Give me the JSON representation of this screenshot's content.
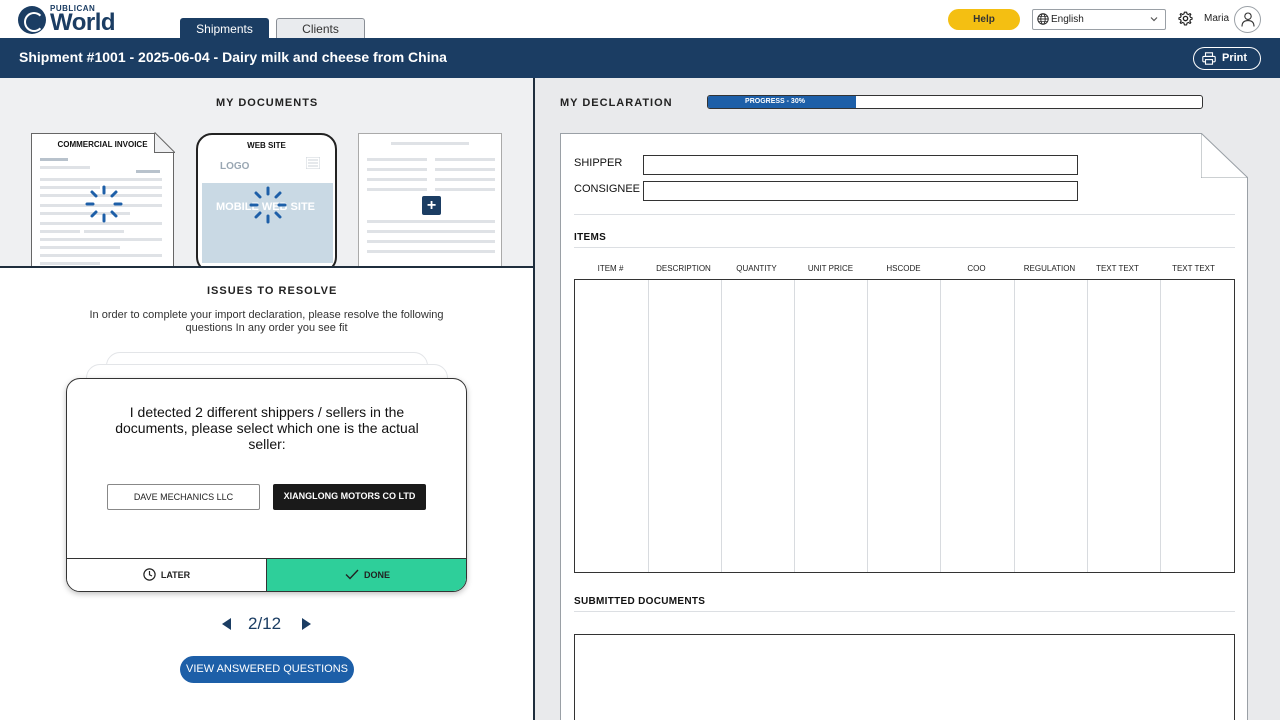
{
  "brand": {
    "logo_sub": "PUBLICAN",
    "logo_main": "World"
  },
  "nav": {
    "tabs": [
      {
        "label": "Shipments",
        "active": true
      },
      {
        "label": "Clients",
        "active": false
      }
    ]
  },
  "header": {
    "help_label": "Help",
    "language": "English",
    "user_name": "Maria"
  },
  "shipment": {
    "title": "Shipment #1001 - 2025-06-04 - Dairy milk and cheese from China",
    "print_label": "Print"
  },
  "documents": {
    "heading": "MY DOCUMENTS",
    "cards": [
      {
        "label": "COMMERCIAL INVOICE",
        "loading": true
      },
      {
        "label": "WEB SITE",
        "loading": true,
        "logo_text": "LOGO",
        "hero_text": "MOBILE WEB SITE"
      },
      {
        "label": "",
        "action": "add"
      }
    ]
  },
  "issues": {
    "heading": "ISSUES TO RESOLVE",
    "intro": "In order to complete your import declaration, please resolve the following questions In any order you see fit",
    "question": "I detected 2 different shippers / sellers in the documents, please select which one is the actual seller:",
    "options": [
      {
        "label": "DAVE MECHANICS LLC",
        "selected": false
      },
      {
        "label": "XIANGLONG MOTORS CO LTD",
        "selected": true
      }
    ],
    "later_label": "LATER",
    "done_label": "DONE",
    "pager": "2/12",
    "view_answered_label": "VIEW ANSWERED QUESTIONS"
  },
  "declaration": {
    "heading": "MY DECLARATION",
    "progress_label": "PROGRESS - 30%",
    "progress_value": 0.3,
    "shipper_label": "SHIPPER",
    "shipper_value": "",
    "consignee_label": "CONSIGNEE",
    "consignee_value": "",
    "items_heading": "ITEMS",
    "columns": [
      "ITEM #",
      "DESCRIPTION",
      "QUANTITY",
      "UNIT PRICE",
      "HSCODE",
      "COO",
      "REGULATION",
      "TEXT TEXT",
      "TEXT TEXT"
    ],
    "submitted_heading": "SUBMITTED DOCUMENTS"
  },
  "colors": {
    "navy": "#1b3d63",
    "help_yellow": "#f4bf12",
    "done_green": "#2ecf9a",
    "accent_blue": "#1d5fa8"
  }
}
